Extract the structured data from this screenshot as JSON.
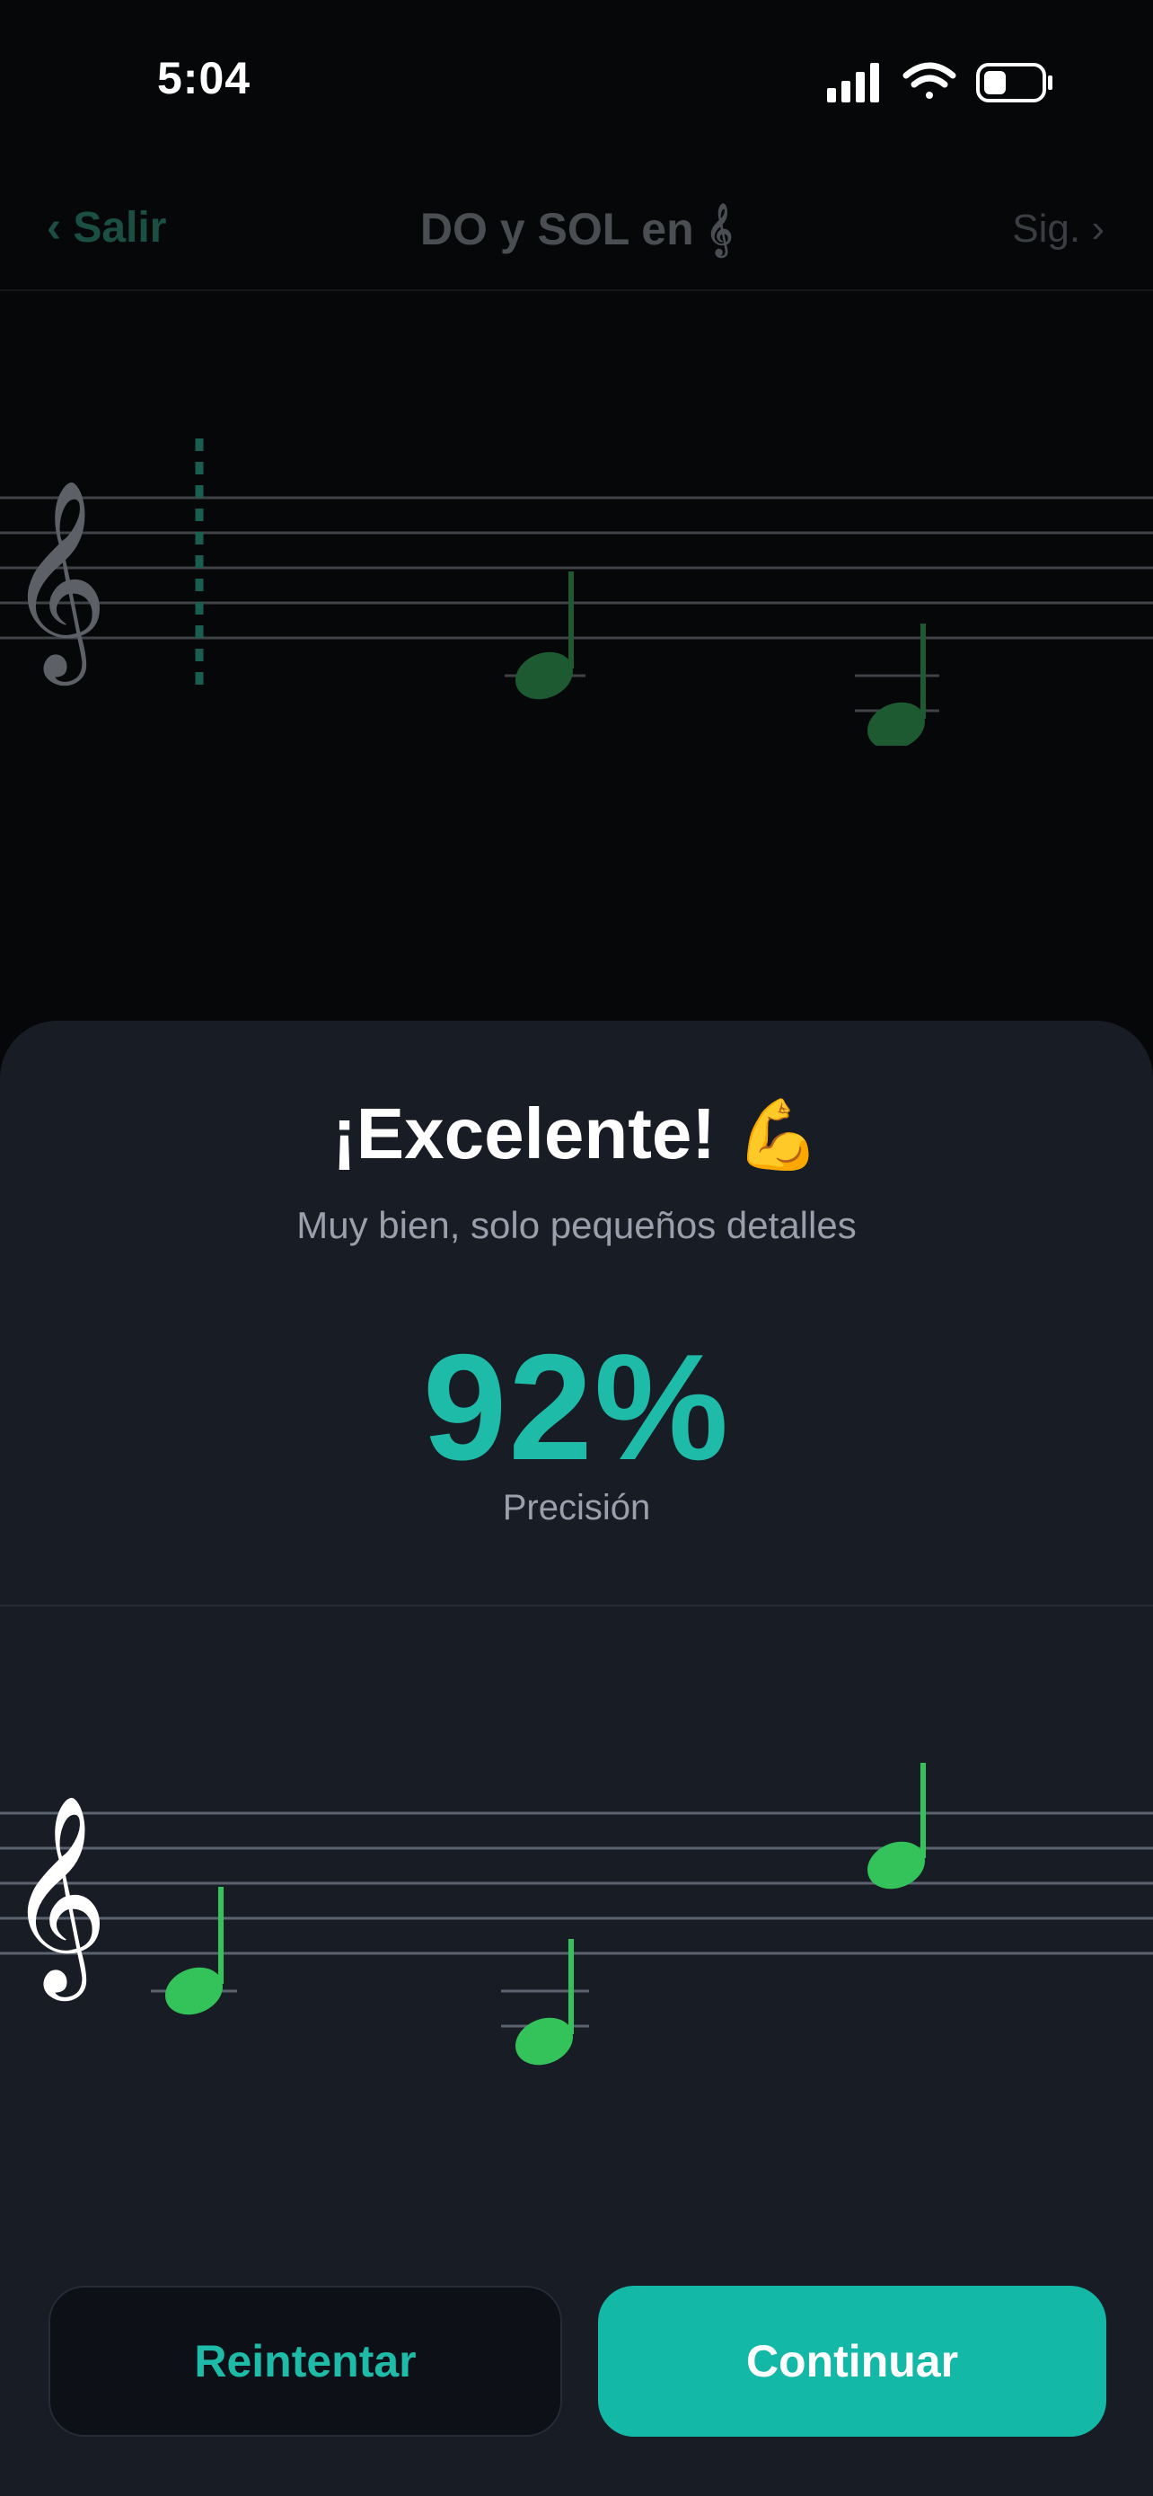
{
  "status_bar": {
    "time": "5:04"
  },
  "nav": {
    "back_label": "‹ Salir",
    "title": "DO y SOL en 𝄞",
    "next_label": "Sig. ›"
  },
  "result": {
    "title": "¡Excelente!",
    "emoji": "💪",
    "subtitle": "Muy bien, solo pequeños detalles",
    "accuracy_value": "92%",
    "accuracy_label": "Precisión"
  },
  "buttons": {
    "retry_label": "Reintentar",
    "continue_label": "Continuar"
  },
  "colors": {
    "accent": "#14b8a6",
    "note_green": "#34c35a",
    "sheet_bg": "#181c25"
  },
  "icons": [
    "cellular-signal-icon",
    "wifi-icon",
    "battery-icon",
    "treble-clef-icon",
    "music-note-icon"
  ]
}
